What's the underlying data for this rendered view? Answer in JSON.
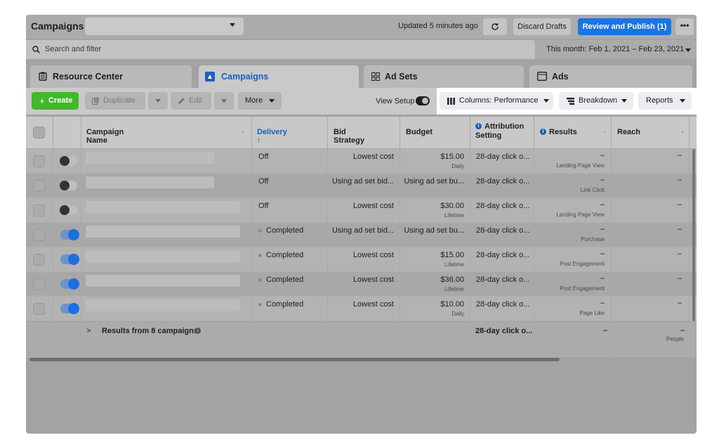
{
  "header": {
    "title": "Campaigns",
    "updated_text": "Updated 5 minutes ago",
    "discard_label": "Discard Drafts",
    "publish_label": "Review and Publish (1)",
    "more_label": "•••"
  },
  "search": {
    "placeholder": "Search and filter",
    "date_range": "This month: Feb 1, 2021 – Feb 23, 2021"
  },
  "tabs": [
    {
      "label": "Resource Center",
      "icon": "resource-center-icon"
    },
    {
      "label": "Campaigns",
      "icon": "campaigns-flag-icon",
      "active": true
    },
    {
      "label": "Ad Sets",
      "icon": "ad-sets-grid-icon"
    },
    {
      "label": "Ads",
      "icon": "ads-window-icon"
    }
  ],
  "toolbar": {
    "create": "Create",
    "duplicate": "Duplicate",
    "edit": "Edit",
    "more": "More",
    "view_setup": "View Setup",
    "columns": "Columns: Performance",
    "breakdown": "Breakdown",
    "reports": "Reports"
  },
  "columns": {
    "name": "Campaign Name",
    "delivery": "Delivery ↑",
    "bid": "Bid Strategy",
    "budget": "Budget",
    "attribution": "Attribution Setting",
    "results": "Results",
    "reach": "Reach"
  },
  "rows": [
    {
      "on": false,
      "delivery": "Off",
      "completed": false,
      "bid": "Lowest cost",
      "budget": "$15.00",
      "budget_type": "Daily",
      "attribution": "28-day click o...",
      "results": "–",
      "result_type": "Landing Page View",
      "reach": "–"
    },
    {
      "on": false,
      "delivery": "Off",
      "completed": false,
      "bid": "Using ad set bid...",
      "budget": "Using ad set bu...",
      "budget_type": "",
      "attribution": "28-day click o...",
      "results": "–",
      "result_type": "Link Click",
      "reach": "–"
    },
    {
      "on": false,
      "delivery": "Off",
      "completed": false,
      "bid": "Lowest cost",
      "budget": "$30.00",
      "budget_type": "Lifetime",
      "attribution": "28-day click o...",
      "results": "–",
      "result_type": "Landing Page View",
      "reach": "–"
    },
    {
      "on": true,
      "delivery": "Completed",
      "completed": true,
      "bid": "Using ad set bid...",
      "budget": "Using ad set bu...",
      "budget_type": "",
      "attribution": "28-day click o...",
      "results": "–",
      "result_type": "Purchase",
      "reach": "–"
    },
    {
      "on": true,
      "delivery": "Completed",
      "completed": true,
      "bid": "Lowest cost",
      "budget": "$15.00",
      "budget_type": "Lifetime",
      "attribution": "28-day click o...",
      "results": "–",
      "result_type": "Post Engagement",
      "reach": "–"
    },
    {
      "on": true,
      "delivery": "Completed",
      "completed": true,
      "bid": "Lowest cost",
      "budget": "$36.00",
      "budget_type": "Lifetime",
      "attribution": "28-day click o...",
      "results": "–",
      "result_type": "Post Engagement",
      "reach": "–"
    },
    {
      "on": true,
      "delivery": "Completed",
      "completed": true,
      "bid": "Lowest cost",
      "budget": "$10.00",
      "budget_type": "Daily",
      "attribution": "28-day click o...",
      "results": "–",
      "result_type": "Page Like",
      "reach": "–"
    }
  ],
  "summary": {
    "label": "Results from 8 campaigns",
    "attribution": "28-day click o...",
    "results": "–",
    "reach": "–",
    "reach_unit": "People"
  }
}
